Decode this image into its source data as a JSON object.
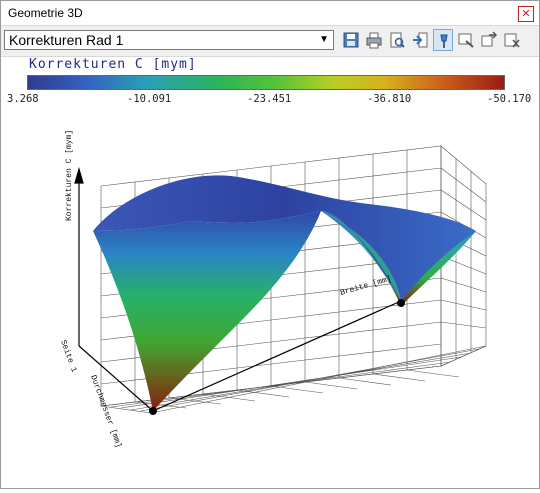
{
  "window": {
    "title": "Geometrie 3D"
  },
  "toolbar": {
    "selected": "Korrekturen Rad 1",
    "buttons": [
      {
        "icon": "save-icon"
      },
      {
        "icon": "print-icon"
      },
      {
        "icon": "print-preview-icon"
      },
      {
        "icon": "export-icon"
      },
      {
        "icon": "pin-icon"
      },
      {
        "icon": "settings-icon"
      },
      {
        "icon": "arrow-icon"
      },
      {
        "icon": "close-view-icon"
      }
    ]
  },
  "legend": {
    "title": "Korrekturen C [mym]",
    "ticks": [
      "3.268",
      "-10.091",
      "-23.451",
      "-36.810",
      "-50.170"
    ]
  },
  "plot": {
    "z_axis_label": "Korrekturen C [mym]",
    "x_axis_label": "Breite [mm]",
    "y_axis_label": "Durchmesser [mm]",
    "series_label": "Seite 1"
  },
  "colors": {
    "low": "#9a1b14",
    "high": "#303c90"
  }
}
